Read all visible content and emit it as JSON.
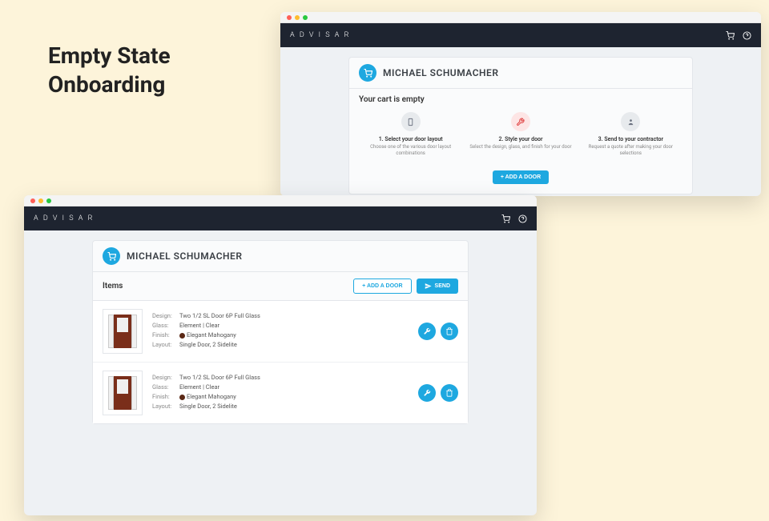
{
  "page": {
    "heading_line1": "Empty State",
    "heading_line2": "Onboarding"
  },
  "brand": "A D V I S A R",
  "user_name": "MICHAEL SCHUMACHER",
  "empty_cart": {
    "subtitle": "Your cart is empty",
    "steps": [
      {
        "title": "1. Select your door layout",
        "desc": "Choose one of the various door layout combinations"
      },
      {
        "title": "2. Style your door",
        "desc": "Select the design, glass, and finish for your door"
      },
      {
        "title": "3. Send to your contractor",
        "desc": "Request a quote after making your door selections"
      }
    ],
    "add_button": "+ ADD A DOOR"
  },
  "cart": {
    "items_label": "Items",
    "add_button": "+ ADD A DOOR",
    "send_button": "SEND",
    "spec_labels": {
      "design": "Design:",
      "glass": "Glass:",
      "finish": "Finish:",
      "layout": "Layout:"
    },
    "items": [
      {
        "design": "Two 1/2 SL Door 6P Full Glass",
        "glass": "Element | Clear",
        "finish": "Elegant Mahogany",
        "layout": "Single Door, 2 Sidelite"
      },
      {
        "design": "Two 1/2 SL Door 6P Full Glass",
        "glass": "Element | Clear",
        "finish": "Elegant Mahogany",
        "layout": "Single Door, 2 Sidelite"
      }
    ]
  }
}
